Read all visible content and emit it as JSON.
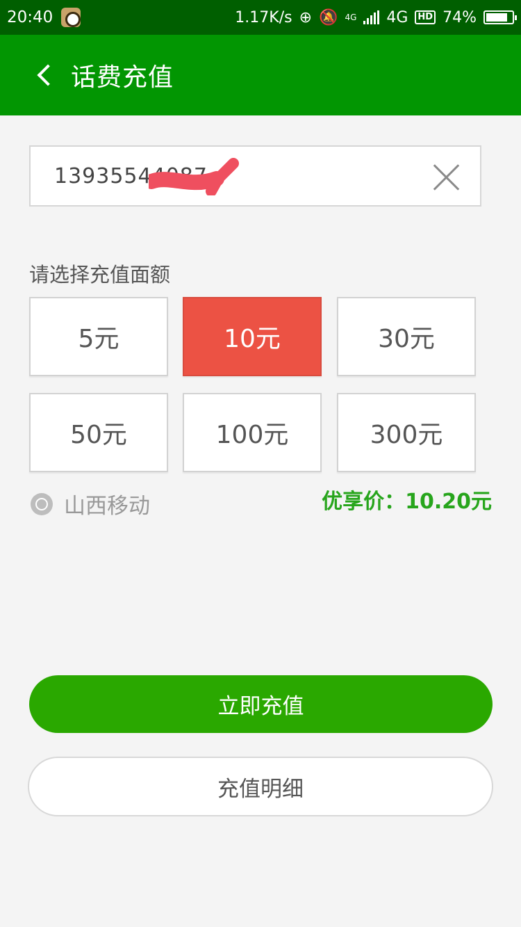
{
  "status_bar": {
    "time": "20:40",
    "speed": "1.17K/s",
    "network_small": "4G",
    "network": "4G",
    "hd": "HD",
    "battery": "74%",
    "battery_level": 0.74
  },
  "header": {
    "title": "话费充值"
  },
  "phone": {
    "value": "13935544087"
  },
  "amount_section": {
    "label": "请选择充值面额",
    "options": [
      "5元",
      "10元",
      "30元",
      "50元",
      "100元",
      "300元"
    ],
    "selected_index": 1
  },
  "carrier": {
    "name": "山西移动"
  },
  "price": {
    "text": "优享价：10.20元"
  },
  "actions": {
    "recharge": "立即充值",
    "details": "充值明细"
  },
  "colors": {
    "header_green": "#029602",
    "status_green": "#005f00",
    "accent_red": "#ec5244",
    "button_green": "#2aa800",
    "price_green": "#27a51c"
  }
}
